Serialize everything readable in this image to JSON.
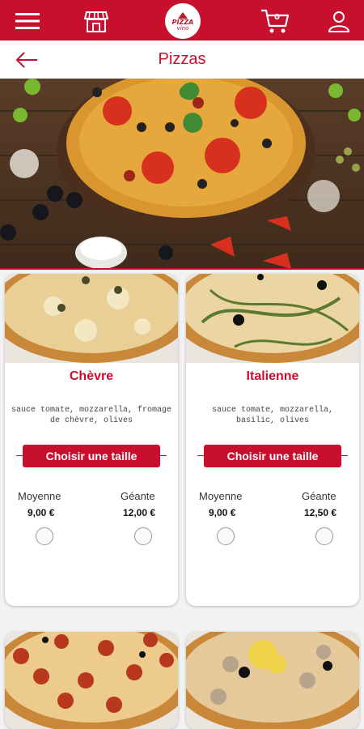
{
  "header": {
    "menu_icon": "hamburger-menu-icon",
    "shop_icon": "storefront-icon",
    "logo_line1": "PIZZA",
    "logo_line2": "vino",
    "cart_icon": "shopping-cart-icon",
    "cart_count": "0",
    "user_icon": "user-account-icon"
  },
  "page": {
    "title": "Pizzas",
    "back_icon": "arrow-left-icon"
  },
  "products": [
    {
      "name": "Chèvre",
      "description": "sauce tomate, mozzarella, fromage de chèvre, olives",
      "choose_size_label": "Choisir une taille",
      "sizes": [
        {
          "label": "Moyenne",
          "price": "9,00 €"
        },
        {
          "label": "Géante",
          "price": "12,00 €"
        }
      ]
    },
    {
      "name": "Italienne",
      "description": "sauce tomate, mozzarella, basilic, olives",
      "choose_size_label": "Choisir une taille",
      "sizes": [
        {
          "label": "Moyenne",
          "price": "9,00 €"
        },
        {
          "label": "Géante",
          "price": "12,50 €"
        }
      ]
    }
  ],
  "colors": {
    "brand_red": "#c8102e",
    "background": "#f2f2f2"
  }
}
